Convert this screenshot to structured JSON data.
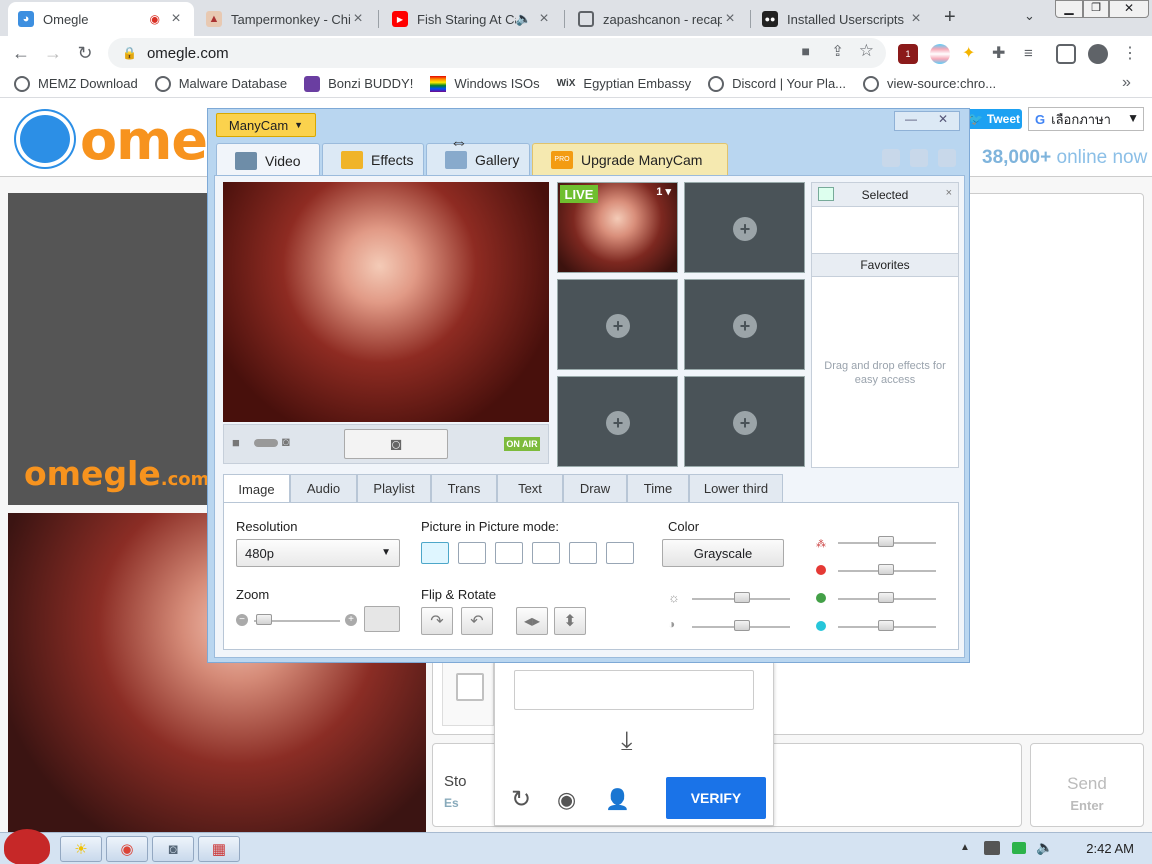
{
  "browser": {
    "tabs": [
      {
        "title": "Omegle",
        "icon": "omegle-icon",
        "recording": true,
        "active": true
      },
      {
        "title": "Tampermonkey - Chi",
        "icon": "tampermonkey-icon"
      },
      {
        "title": "Fish Staring At Ca",
        "icon": "youtube-icon",
        "audio": true
      },
      {
        "title": "zapashcanon - recap",
        "icon": "page-icon"
      },
      {
        "title": "Installed Userscripts",
        "icon": "userscripts-icon"
      }
    ],
    "new_tab": "+",
    "url": "omegle.com",
    "bookmarks": [
      {
        "label": "MEMZ Download"
      },
      {
        "label": "Malware Database"
      },
      {
        "label": "Bonzi BUDDY!"
      },
      {
        "label": "Windows ISOs"
      },
      {
        "label": "Egyptian Embassy"
      },
      {
        "label": "Discord | Your Pla..."
      },
      {
        "label": "view-source:chro..."
      }
    ],
    "bookmarks_more": "»",
    "ext_badge": "1"
  },
  "omegle": {
    "logo": "omegle",
    "tweet": "Tweet",
    "language": "เลือกภาษา",
    "online_count": "38,000+",
    "online_label": "online now",
    "watermark": "omegle",
    "watermark_suffix": ".com",
    "stop_label": "Sto",
    "stop_sub": "Es",
    "send_label": "Send",
    "send_sub": "Enter"
  },
  "captcha": {
    "verify": "VERIFY"
  },
  "manycam": {
    "menu_label": "ManyCam",
    "tabs": [
      {
        "label": "Video",
        "active": true
      },
      {
        "label": "Effects"
      },
      {
        "label": "Gallery"
      },
      {
        "label": "Upgrade ManyCam",
        "badge": "PRO"
      }
    ],
    "live_badge": "LIVE",
    "slot_number": "1",
    "on_air": "ON AIR",
    "selected_title": "Selected",
    "favorites_title": "Favorites",
    "drag_hint": "Drag and drop effects for easy access",
    "lower_tabs": [
      "Image",
      "Audio",
      "Playlist",
      "Trans",
      "Text",
      "Draw",
      "Time",
      "Lower third"
    ],
    "resolution_label": "Resolution",
    "resolution_value": "480p",
    "pip_label": "Picture in Picture mode:",
    "color_label": "Color",
    "grayscale": "Grayscale",
    "zoom_label": "Zoom",
    "flip_label": "Flip & Rotate",
    "colors": {
      "red": "#e53935",
      "green": "#43a047",
      "blue": "#26c6da"
    }
  },
  "taskbar": {
    "clock": "2:42 AM"
  }
}
